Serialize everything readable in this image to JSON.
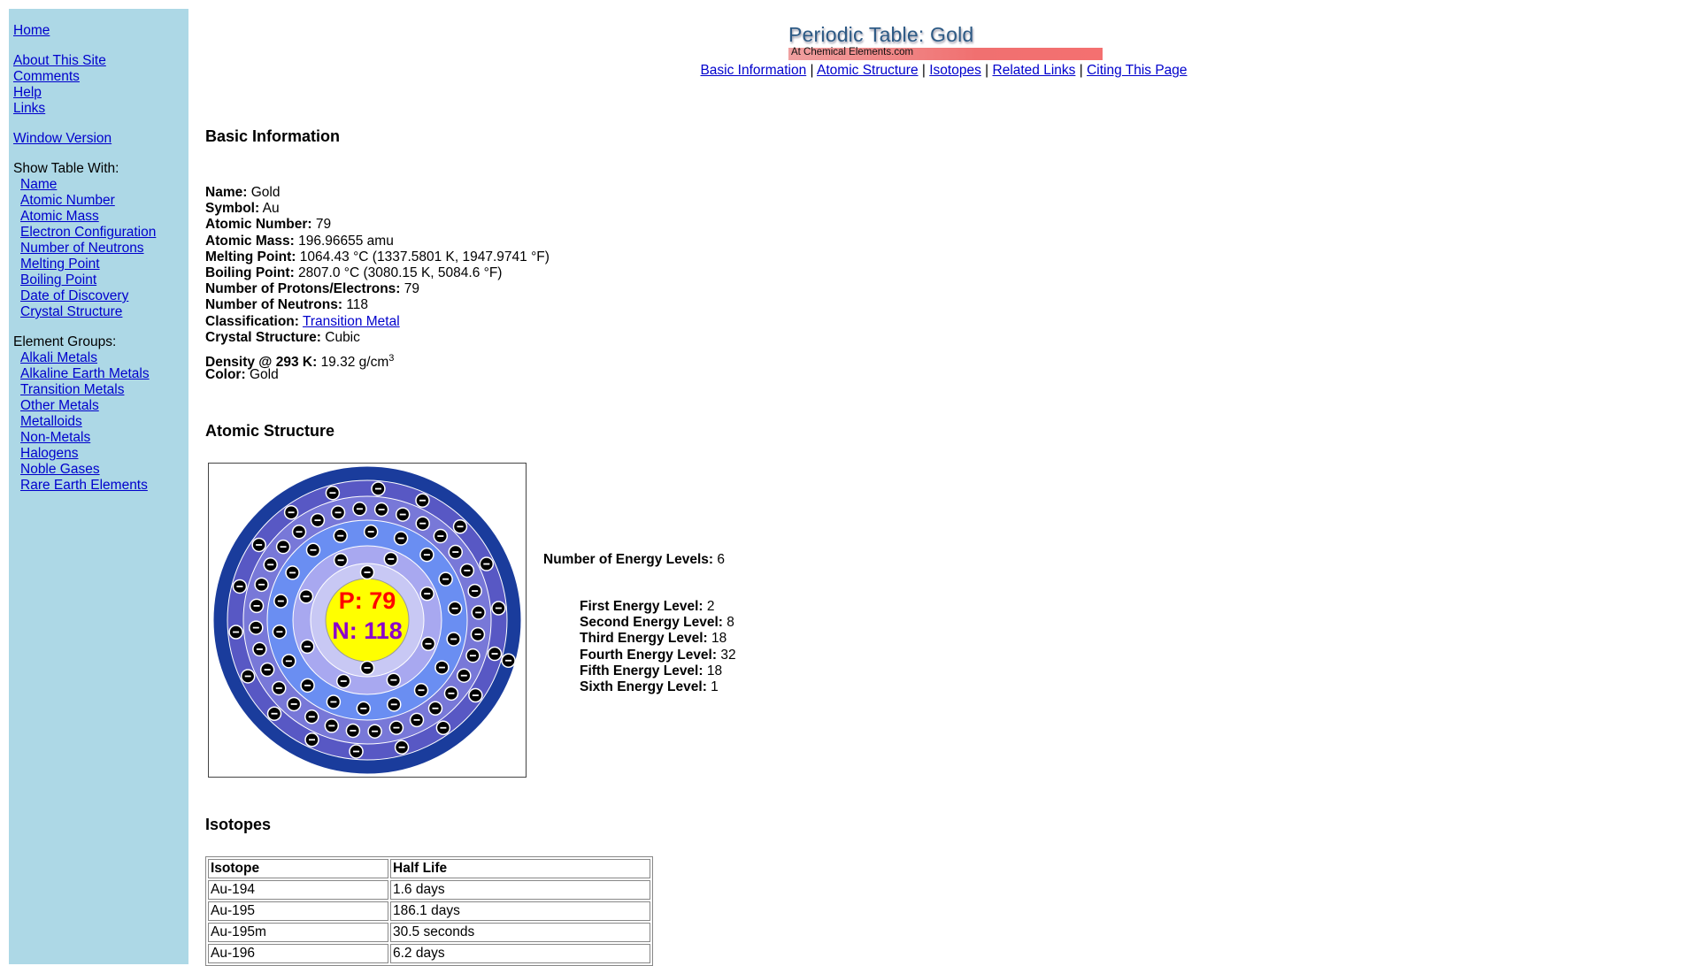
{
  "sidebar": {
    "home": "Home",
    "about": "About This Site",
    "comments": "Comments",
    "help": "Help",
    "links": "Links",
    "window_version": "Window Version",
    "show_table_with": "Show Table With:",
    "table_options": [
      "Name",
      "Atomic Number",
      "Atomic Mass",
      "Electron Configuration",
      "Number of Neutrons",
      "Melting Point",
      "Boiling Point",
      "Date of Discovery",
      "Crystal Structure"
    ],
    "element_groups_label": "Element Groups:",
    "element_groups": [
      "Alkali Metals",
      "Alkaline Earth Metals",
      "Transition Metals",
      "Other Metals",
      "Metalloids",
      "Non-Metals",
      "Halogens",
      "Noble Gases",
      "Rare Earth Elements"
    ]
  },
  "header": {
    "logo_title": "Periodic Table: Gold",
    "logo_subtitle": "At Chemical Elements.com",
    "nav": [
      "Basic Information",
      "Atomic Structure",
      "Isotopes",
      "Related Links",
      "Citing This Page"
    ],
    "separator": "|"
  },
  "basic": {
    "heading": "Basic Information",
    "name_label": "Name:",
    "name": "Gold",
    "symbol_label": "Symbol:",
    "symbol": "Au",
    "atomic_number_label": "Atomic Number:",
    "atomic_number": "79",
    "atomic_mass_label": "Atomic Mass:",
    "atomic_mass": "196.96655 amu",
    "melting_label": "Melting Point:",
    "melting": "1064.43 °C (1337.5801 K, 1947.9741 °F)",
    "boiling_label": "Boiling Point:",
    "boiling": "2807.0 °C (3080.15 K, 5084.6 °F)",
    "protons_label": "Number of Protons/Electrons:",
    "protons": "79",
    "neutrons_label": "Number of Neutrons:",
    "neutrons": "118",
    "classification_label": "Classification:",
    "classification": "Transition Metal",
    "crystal_label": "Crystal Structure:",
    "crystal": "Cubic",
    "density_label": "Density @ 293 K:",
    "density": "19.32 g/cm",
    "density_exp": "3",
    "color_label": "Color:",
    "color": "Gold"
  },
  "atomic": {
    "heading": "Atomic Structure",
    "nucleus_p": "P: 79",
    "nucleus_n": "N: 118",
    "shells": [
      2,
      8,
      18,
      32,
      18,
      1
    ],
    "shell_colors": [
      "#c8c8f4",
      "#a8a8f0",
      "#6a8ef2",
      "#7878d8",
      "#5858c4",
      "#1a3c9c"
    ],
    "nucleus_color": "#ffff00",
    "energy_levels_label": "Number of Energy Levels:",
    "energy_levels": "6",
    "levels": [
      {
        "label": "First Energy Level:",
        "value": "2"
      },
      {
        "label": "Second Energy Level:",
        "value": "8"
      },
      {
        "label": "Third Energy Level:",
        "value": "18"
      },
      {
        "label": "Fourth Energy Level:",
        "value": "32"
      },
      {
        "label": "Fifth Energy Level:",
        "value": "18"
      },
      {
        "label": "Sixth Energy Level:",
        "value": "1"
      }
    ]
  },
  "isotopes": {
    "heading": "Isotopes",
    "col_isotope": "Isotope",
    "col_half_life": "Half Life",
    "rows": [
      {
        "isotope": "Au-194",
        "half_life": "1.6 days"
      },
      {
        "isotope": "Au-195",
        "half_life": "186.1 days"
      },
      {
        "isotope": "Au-195m",
        "half_life": "30.5 seconds"
      },
      {
        "isotope": "Au-196",
        "half_life": "6.2 days"
      }
    ]
  }
}
